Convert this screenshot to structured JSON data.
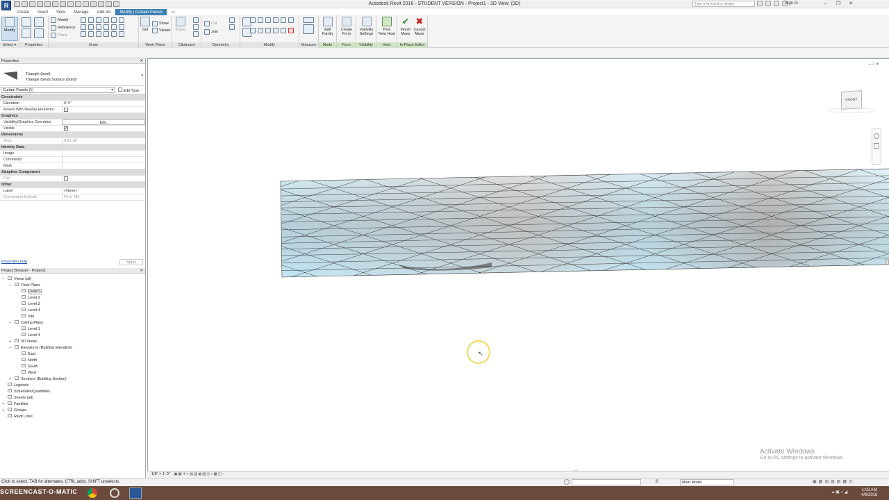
{
  "window": {
    "title": "Autodesk Revit 2016 -  STUDENT VERSION -    Project1 - 3D View: {3D}",
    "search_placeholder": "Type a keyword or phrase",
    "sign_in": "Sign In",
    "app_button": "R"
  },
  "tabs": [
    "Create",
    "Insert",
    "View",
    "Manage",
    "Add-Ins",
    "Modify | Curtain Panels"
  ],
  "active_tab_index": 5,
  "ribbon": {
    "panels": [
      {
        "label": "Select ▾"
      },
      {
        "label": "Properties"
      },
      {
        "label": "Draw"
      },
      {
        "label": "Work Plane"
      },
      {
        "label": "Clipboard"
      },
      {
        "label": "Geometry"
      },
      {
        "label": "Modify"
      },
      {
        "label": "Measure"
      },
      {
        "label": "Mode"
      },
      {
        "label": "Form"
      },
      {
        "label": "Visibility"
      },
      {
        "label": "Host"
      },
      {
        "label": "In-Place Editor"
      }
    ],
    "buttons": {
      "modify": "Modify",
      "model": "Model",
      "reference": "Reference",
      "plane": "Plane",
      "show": "Show",
      "set": "Set",
      "viewer": "Viewer",
      "paste": "Paste",
      "cut": "Cut",
      "join": "Join",
      "edit_family_1": "Edit",
      "edit_family_2": "Family",
      "create_form_1": "Create",
      "create_form_2": "Form",
      "visibility_1": "Visibility",
      "visibility_2": "Settings",
      "pick_host_1": "Pick",
      "pick_host_2": "New Host",
      "finish_1": "Finish",
      "finish_2": "Mass",
      "cancel_1": "Cancel",
      "cancel_2": "Mass"
    }
  },
  "properties": {
    "title": "Properties",
    "close": "✕",
    "type_line1": "Triangle (bent)",
    "type_line2": "Triangle (bent) Surface (Solid)",
    "selector": "Curtain Panels (1)",
    "edit_type": "Edit Type",
    "rows": [
      {
        "group": "Constraints"
      },
      {
        "k": "Elevation",
        "v": "0'  0\""
      },
      {
        "k": "Moves With Nearby Elements",
        "check": "unchecked"
      },
      {
        "group": "Graphics"
      },
      {
        "k": "Visibility/Graphics Overrides",
        "v": "Edit..."
      },
      {
        "k": "Visible",
        "check": "checked"
      },
      {
        "group": "Dimensions"
      },
      {
        "k": "Area",
        "v": "4.83 SF",
        "dim": true
      },
      {
        "group": "Identity Data"
      },
      {
        "k": "Image",
        "v": ""
      },
      {
        "k": "Comments",
        "v": ""
      },
      {
        "k": "Mark",
        "v": ""
      },
      {
        "group": "Adaptive Component"
      },
      {
        "k": "Flip",
        "check": "unchecked",
        "dim": true
      },
      {
        "group": "Other"
      },
      {
        "k": "Label",
        "v": "<None>"
      },
      {
        "k": "Component Extents",
        "v": "Fit to Tile",
        "dim": true
      }
    ],
    "help_link": "Properties help",
    "apply": "Apply"
  },
  "browser": {
    "title": "Project Browser - Project1",
    "close": "✕",
    "items": [
      {
        "label": "Views (all)",
        "indent": 0,
        "toggle": "−"
      },
      {
        "label": "Floor Plans",
        "indent": 1,
        "toggle": "−"
      },
      {
        "label": "Level 1",
        "indent": 2,
        "selected": true
      },
      {
        "label": "Level 2",
        "indent": 2
      },
      {
        "label": "Level 3",
        "indent": 2
      },
      {
        "label": "Level 4",
        "indent": 2
      },
      {
        "label": "Site",
        "indent": 2
      },
      {
        "label": "Ceiling Plans",
        "indent": 1,
        "toggle": "−"
      },
      {
        "label": "Level 1",
        "indent": 2
      },
      {
        "label": "Level 4",
        "indent": 2
      },
      {
        "label": "3D Views",
        "indent": 1,
        "toggle": "+"
      },
      {
        "label": "Elevations (Building Elevation)",
        "indent": 1,
        "toggle": "−"
      },
      {
        "label": "East",
        "indent": 2
      },
      {
        "label": "North",
        "indent": 2
      },
      {
        "label": "South",
        "indent": 2
      },
      {
        "label": "West",
        "indent": 2
      },
      {
        "label": "Sections (Building Section)",
        "indent": 1,
        "toggle": "+"
      },
      {
        "label": "Legends",
        "indent": 0
      },
      {
        "label": "Schedules/Quantities",
        "indent": 0
      },
      {
        "label": "Sheets (all)",
        "indent": 0
      },
      {
        "label": "Families",
        "indent": 0,
        "toggle": "+"
      },
      {
        "label": "Groups",
        "indent": 0,
        "toggle": "+"
      },
      {
        "label": "Revit Links",
        "indent": 0
      }
    ]
  },
  "view": {
    "viewcube_face": "FRONT",
    "scale": "1/8\" = 1'-0\""
  },
  "status": {
    "text": "Click to select, TAB for alternates, CTRL adds, SHIFT unselects.",
    "workset": "Main Model",
    "zero": ":0"
  },
  "watermark": {
    "line1": "Activate Windows",
    "line2": "Go to PC settings to activate Windows."
  },
  "taskbar": {
    "recorder": "SCREENCAST-O-MATIC",
    "time": "1:03 AM",
    "date": "4/6/2016"
  },
  "colors": {
    "panel_blue": "#bfe6f5",
    "panel_gray": "#c9c9c9",
    "active_tab": "#3c7fb1",
    "taskbar": "#6a4a3c"
  }
}
